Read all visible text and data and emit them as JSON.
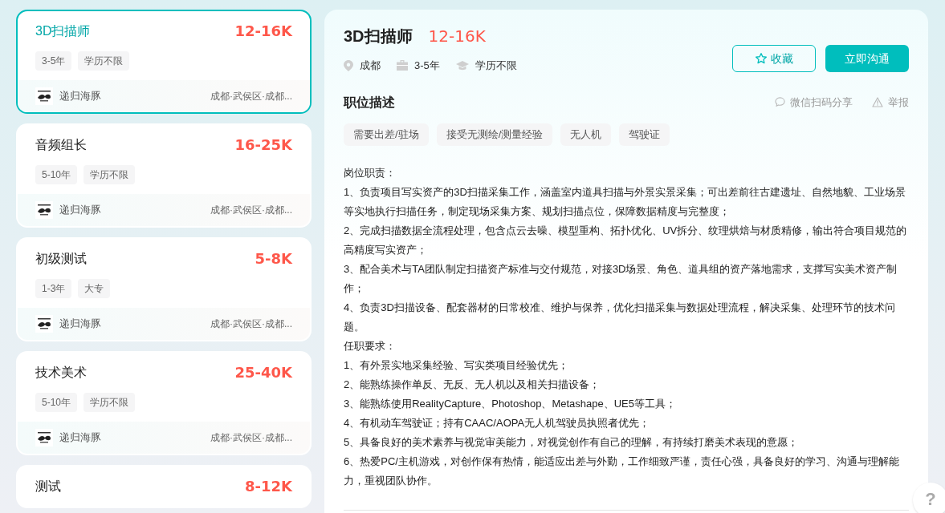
{
  "jobs": [
    {
      "title": "3D扫描师",
      "salary": "12-16K",
      "tags": [
        "3-5年",
        "学历不限"
      ],
      "company": "递归海豚",
      "location": "成都·武侯区·成都...",
      "selected": true
    },
    {
      "title": "音频组长",
      "salary": "16-25K",
      "tags": [
        "5-10年",
        "学历不限"
      ],
      "company": "递归海豚",
      "location": "成都·武侯区·成都...",
      "selected": false
    },
    {
      "title": "初级测试",
      "salary": "5-8K",
      "tags": [
        "1-3年",
        "大专"
      ],
      "company": "递归海豚",
      "location": "成都·武侯区·成都...",
      "selected": false
    },
    {
      "title": "技术美术",
      "salary": "25-40K",
      "tags": [
        "5-10年",
        "学历不限"
      ],
      "company": "递归海豚",
      "location": "成都·武侯区·成都...",
      "selected": false
    },
    {
      "title": "测试",
      "salary": "8-12K",
      "selected": false
    }
  ],
  "detail": {
    "title": "3D扫描师",
    "salary": "12-16K",
    "meta": [
      {
        "kind": "location",
        "text": "成都"
      },
      {
        "kind": "experience",
        "text": "3-5年"
      },
      {
        "kind": "education",
        "text": "学历不限"
      }
    ],
    "favorite_button": "收藏",
    "chat_button": "立即沟通",
    "section_title": "职位描述",
    "share": "微信扫码分享",
    "report": "举报",
    "tags": [
      "需要出差/驻场",
      "接受无测绘/测量经验",
      "无人机",
      "驾驶证"
    ],
    "description": [
      "岗位职责：",
      "1、负责项目写实资产的3D扫描采集工作，涵盖室内道具扫描与外景实景采集；可出差前往古建遗址、自然地貌、工业场景等实地执行扫描任务，制定现场采集方案、规划扫描点位，保障数据精度与完整度；",
      "2、完成扫描数据全流程处理，包含点云去噪、模型重构、拓扑优化、UV拆分、纹理烘焙与材质精修，输出符合项目规范的高精度写实资产；",
      "3、配合美术与TA团队制定扫描资产标准与交付规范，对接3D场景、角色、道具组的资产落地需求，支撑写实美术资产制作；",
      "4、负责3D扫描设备、配套器材的日常校准、维护与保养，优化扫描采集与数据处理流程，解决采集、处理环节的技术问题。",
      "任职要求：",
      "1、有外景实地采集经验、写实类项目经验优先；",
      "2、能熟练操作单反、无反、无人机以及相关扫描设备；",
      "3、能熟练使用RealityCapture、Photoshop、Metashape、UE5等工具；",
      "4、有机动车驾驶证；持有CAAC/AOPA无人机驾驶员执照者优先；",
      "5、具备良好的美术素养与视觉审美能力，对视觉创作有自己的理解，有持续打磨美术表现的意愿；",
      "6、热爱PC/主机游戏，对创作保有热情，能适应出差与外勤，工作细致严谨，责任心强，具备良好的学习、沟通与理解能力，重视团队协作。"
    ]
  },
  "help_button": "?"
}
